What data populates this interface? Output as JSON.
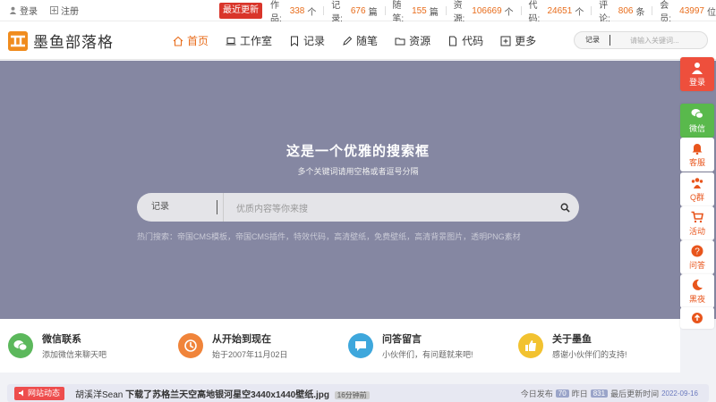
{
  "topbar": {
    "login": "登录",
    "register": "注册",
    "latest": "最近更新",
    "stats": [
      {
        "label": "作品:",
        "value": "338",
        "unit": "个"
      },
      {
        "label": "记录:",
        "value": "676",
        "unit": "篇"
      },
      {
        "label": "随笔:",
        "value": "155",
        "unit": "篇"
      },
      {
        "label": "资源:",
        "value": "106669",
        "unit": "个"
      },
      {
        "label": "代码:",
        "value": "24651",
        "unit": "个"
      },
      {
        "label": "评论:",
        "value": "806",
        "unit": "条"
      },
      {
        "label": "会员:",
        "value": "43997",
        "unit": "位"
      }
    ]
  },
  "header": {
    "logo_text": "墨鱼部落格",
    "nav": [
      {
        "label": "首页",
        "icon": "home-icon",
        "active": true
      },
      {
        "label": "工作室",
        "icon": "laptop-icon"
      },
      {
        "label": "记录",
        "icon": "bookmark-icon"
      },
      {
        "label": "随笔",
        "icon": "pen-icon"
      },
      {
        "label": "资源",
        "icon": "folder-icon"
      },
      {
        "label": "代码",
        "icon": "file-icon"
      },
      {
        "label": "更多",
        "icon": "plus-square-icon"
      }
    ],
    "search": {
      "select": "记录",
      "placeholder": "请输入关键词..."
    }
  },
  "hero": {
    "title": "这是一个优雅的搜索框",
    "subtitle": "多个关键词请用空格或者逗号分隔",
    "search_select": "记录",
    "search_placeholder": "优质内容等你来搜",
    "hot_label": "热门搜索：",
    "hot_items": [
      "帝国CMS模板",
      "帝国CMS插件",
      "特效代码",
      "高清壁纸",
      "免费壁纸",
      "高清背景图片",
      "透明PNG素材"
    ]
  },
  "features": [
    {
      "title": "微信联系",
      "desc": "添加微信来聊天吧",
      "color": "#5cb85c",
      "icon": "wechat-icon"
    },
    {
      "title": "从开始到现在",
      "desc": "始于2007年11月02日",
      "color": "#f0843a",
      "icon": "clock-icon"
    },
    {
      "title": "问答留言",
      "desc": "小伙伴们，有问题就来吧!",
      "color": "#3ea7dc",
      "icon": "chat-icon"
    },
    {
      "title": "关于墨鱼",
      "desc": "感谢小伙伴们的支持!",
      "color": "#f2c230",
      "icon": "thumb-icon"
    }
  ],
  "news": {
    "tag": "网站动态",
    "user": "胡溪洋Sean",
    "action": "下载了苏格兰天空高地银河星空3440x1440壁纸.jpg",
    "time": "16分钟前",
    "today_label": "今日发布",
    "today_value": "70",
    "yesterday_label": "昨日",
    "yesterday_value": "831",
    "updated_label": "最后更新时间",
    "updated_value": "2022-09-16"
  },
  "sidebar": {
    "login": "登录",
    "wechat": "微信",
    "service": "客服",
    "qq": "Q群",
    "activity": "活动",
    "ask": "问答",
    "night": "黑夜"
  },
  "colors": {
    "accent": "#e86d1c",
    "hero_bg": "#8587a2",
    "latest_bg": "#d9352a"
  }
}
